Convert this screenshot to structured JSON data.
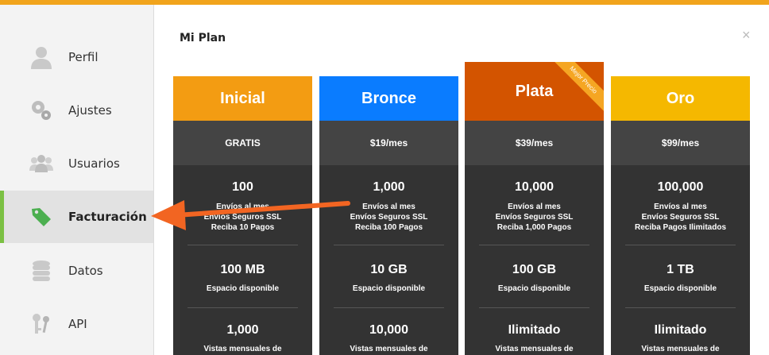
{
  "sidebar": {
    "items": [
      {
        "label": "Perfil",
        "icon": "user-icon",
        "active": false
      },
      {
        "label": "Ajustes",
        "icon": "gears-icon",
        "active": false
      },
      {
        "label": "Usuarios",
        "icon": "users-icon",
        "active": false
      },
      {
        "label": "Facturación",
        "icon": "tag-icon",
        "active": true
      },
      {
        "label": "Datos",
        "icon": "database-icon",
        "active": false
      },
      {
        "label": "API",
        "icon": "keys-icon",
        "active": false
      }
    ]
  },
  "main": {
    "title": "Mi Plan",
    "close_label": "×"
  },
  "colors": {
    "inicial": "#f39c12",
    "bronce": "#0a7cff",
    "plata": "#d35400",
    "oro": "#f5b800",
    "active_accent": "#7bc043",
    "arrow": "#f26522"
  },
  "plans": [
    {
      "name": "Inicial",
      "price": "GRATIS",
      "limit": "100",
      "lines": [
        "Envíos al mes",
        "Envíos Seguros SSL",
        "Reciba 10 Pagos"
      ],
      "storage": "100 MB",
      "storage_label": "Espacio disponible",
      "views": "1,000",
      "views_label": "Vistas mensuales de"
    },
    {
      "name": "Bronce",
      "price": "$19/mes",
      "limit": "1,000",
      "lines": [
        "Envíos al mes",
        "Envíos Seguros SSL",
        "Reciba 100 Pagos"
      ],
      "storage": "10 GB",
      "storage_label": "Espacio disponible",
      "views": "10,000",
      "views_label": "Vistas mensuales de"
    },
    {
      "name": "Plata",
      "price": "$39/mes",
      "limit": "10,000",
      "lines": [
        "Envíos al mes",
        "Envíos Seguros SSL",
        "Reciba 1,000 Pagos"
      ],
      "storage": "100 GB",
      "storage_label": "Espacio disponible",
      "views": "Ilimitado",
      "views_label": "Vistas mensuales de",
      "ribbon": "Mejor Precio"
    },
    {
      "name": "Oro",
      "price": "$99/mes",
      "limit": "100,000",
      "lines": [
        "Envíos al mes",
        "Envíos Seguros SSL",
        "Reciba Pagos Ilimitados"
      ],
      "storage": "1 TB",
      "storage_label": "Espacio disponible",
      "views": "Ilimitado",
      "views_label": "Vistas mensuales de"
    }
  ]
}
